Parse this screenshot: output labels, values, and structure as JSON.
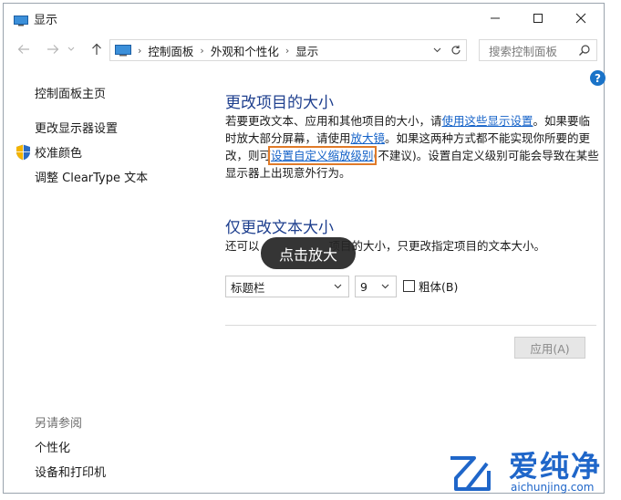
{
  "window": {
    "title": "显示",
    "controls": {
      "minimize": "minimize",
      "maximize": "maximize",
      "close": "close"
    }
  },
  "navigation": {
    "breadcrumbs": [
      "控制面板",
      "外观和个性化",
      "显示"
    ],
    "search_placeholder": "搜索控制面板"
  },
  "help_label": "?",
  "sidebar": {
    "home": "控制面板主页",
    "links": [
      "更改显示器设置",
      "校准颜色",
      "调整 ClearType 文本"
    ],
    "see_also_heading": "另请参阅",
    "see_also": [
      "个性化",
      "设备和打印机"
    ]
  },
  "section1": {
    "title": "更改项目的大小",
    "text_1": "若要更改文本、应用和其他项目的大小，请",
    "link_1": "使用这些显示设置",
    "text_2": "。如果要临时放大部分屏幕，请使用",
    "link_2": "放大镜",
    "text_3": "。如果这两种方式都不能实现你所要的更改，则可",
    "link_3": "设置自定义缩放级别",
    "text_4": "(不建议)。设置自定义级别可能会导致在某些显示器上出现意外行为。"
  },
  "section2": {
    "title": "仅更改文本大小",
    "desc_start": "还可以",
    "desc_end": "项目的大小，只更改指定项目的文本大小。",
    "item_select": "标题栏",
    "size_select": "9",
    "bold_label": "粗体(B)",
    "bold_checked": false
  },
  "apply_button": "应用(A)",
  "tooltip": "点击放大",
  "watermark": {
    "brand": "爱纯净",
    "url": "aichunjing.com"
  },
  "colors": {
    "accent": "#1e3f8e",
    "link": "#1462c8",
    "highlight": "#e07a28"
  }
}
